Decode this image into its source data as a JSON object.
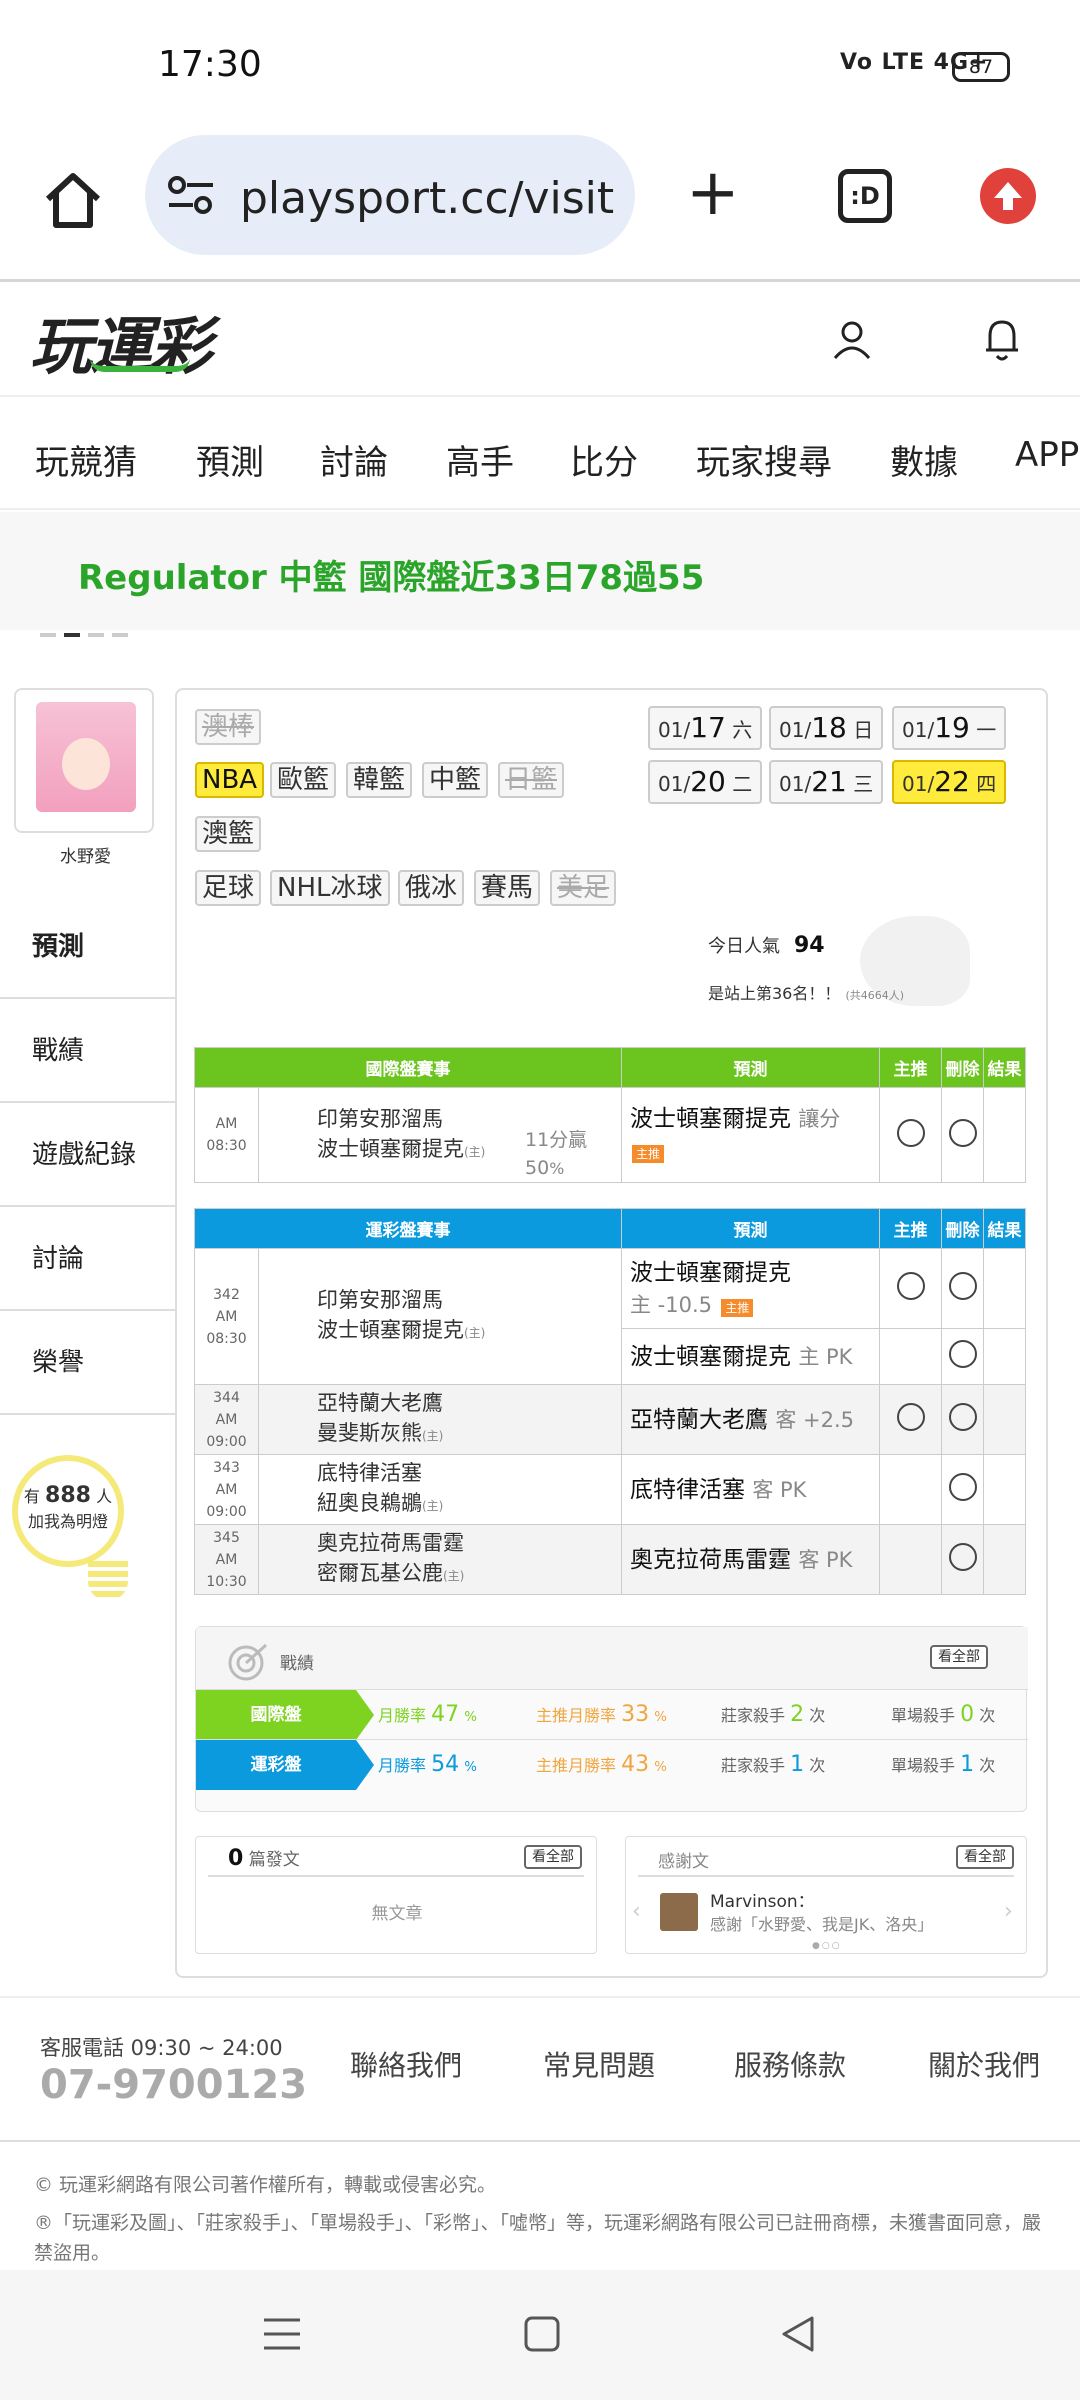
{
  "status_bar": {
    "time": "17:30",
    "signal": "Vo LTE 4G+",
    "battery": "87"
  },
  "browser": {
    "url": "playsport.cc/visit",
    "tabs_label": ":D"
  },
  "site": {
    "logo": "玩運彩"
  },
  "nav": {
    "items": [
      "玩競猜",
      "預測",
      "討論",
      "高手",
      "比分",
      "玩家搜尋",
      "數據",
      "APP"
    ]
  },
  "banner": {
    "text": "Regulator 中籃 國際盤近33日78過55"
  },
  "profile": {
    "name": "水野愛"
  },
  "side_menu": [
    "預測",
    "戰績",
    "遊戲紀錄",
    "討論",
    "榮譽"
  ],
  "fans": {
    "prefix": "有",
    "count": "888",
    "suffix": "人",
    "cta": "加我為明燈"
  },
  "sports": {
    "row1": [
      "澳棒"
    ],
    "row2": [
      "NBA",
      "歐籃",
      "韓籃",
      "中籃",
      "日籃"
    ],
    "row3": [
      "澳籃"
    ],
    "row4": [
      "足球",
      "NHL冰球",
      "俄冰",
      "賽馬",
      "美足"
    ]
  },
  "dates": [
    {
      "md": "01/",
      "d": "17",
      "w": "六"
    },
    {
      "md": "01/",
      "d": "18",
      "w": "日"
    },
    {
      "md": "01/",
      "d": "19",
      "w": "一"
    },
    {
      "md": "01/",
      "d": "20",
      "w": "二"
    },
    {
      "md": "01/",
      "d": "21",
      "w": "三"
    },
    {
      "md": "01/",
      "d": "22",
      "w": "四"
    }
  ],
  "popularity": {
    "label": "今日人氣",
    "value": "94",
    "rank": "是站上第36名！！",
    "total": "(共4664人)"
  },
  "intl_table": {
    "headers": [
      "國際盤賽事",
      "預測",
      "主推",
      "刪除",
      "結果"
    ],
    "row": {
      "time": "AM 08:30",
      "away": "印第安那溜馬",
      "home": "波士頓塞爾提克",
      "home_mark": "(主)",
      "score1": "11分贏",
      "score2": "50",
      "score2_unit": "%",
      "pick": "波士頓塞爾提克",
      "pick_note": "讓分",
      "pick_badge": "主推"
    }
  },
  "sport_table": {
    "headers": [
      "運彩盤賽事",
      "預測",
      "主推",
      "刪除",
      "結果"
    ],
    "rows": [
      {
        "num": "342",
        "time": "AM 08:30",
        "away": "印第安那溜馬",
        "home": "波士頓塞爾提克",
        "pick1": "波士頓塞爾提克",
        "pick1_note": "主 -10.5",
        "pick1_badge": "主推",
        "pick2": "波士頓塞爾提克",
        "pick2_note": "主 PK"
      },
      {
        "num": "344",
        "time": "AM 09:00",
        "away": "亞特蘭大老鷹",
        "home": "曼斐斯灰熊",
        "pick": "亞特蘭大老鷹",
        "pick_note": "客 +2.5"
      },
      {
        "num": "343",
        "time": "AM 09:00",
        "away": "底特律活塞",
        "home": "紐奧良鵜鶘",
        "pick": "底特律活塞",
        "pick_note": "客 PK"
      },
      {
        "num": "345",
        "time": "AM 10:30",
        "away": "奧克拉荷馬雷霆",
        "home": "密爾瓦基公鹿",
        "pick": "奧克拉荷馬雷霆",
        "pick_note": "客 PK"
      }
    ],
    "home_mark": "(主)"
  },
  "record": {
    "title": "戰績",
    "view_all": "看全部",
    "rows": [
      {
        "label": "國際盤",
        "monthly": "月勝率",
        "monthly_v": "47",
        "main": "主推月勝率",
        "main_v": "33",
        "banker": "莊家殺手",
        "banker_v": "2",
        "single": "單場殺手",
        "single_v": "0",
        "pct": "%",
        "unit": "次",
        "color": "#7ed321"
      },
      {
        "label": "運彩盤",
        "monthly": "月勝率",
        "monthly_v": "54",
        "main": "主推月勝率",
        "main_v": "43",
        "banker": "莊家殺手",
        "banker_v": "1",
        "single": "單場殺手",
        "single_v": "1",
        "pct": "%",
        "unit": "次",
        "color": "#0b9ade"
      }
    ]
  },
  "posts": {
    "count": "0",
    "label": "篇發文",
    "view_all": "看全部",
    "empty": "無文章"
  },
  "thanks": {
    "title": "感謝文",
    "view_all": "看全部",
    "user": "Marvinson：",
    "text": "感謝「水野愛、我是JK、洛央」"
  },
  "footer": {
    "tel_label": "客服電話 09:30 ~ 24:00",
    "phone": "07-9700123",
    "links": [
      "聯絡我們",
      "常見問題",
      "服務條款",
      "關於我們"
    ],
    "copyright": "© 玩運彩網路有限公司著作權所有，轉載或侵害必究。",
    "trademark": "®「玩運彩及圖」、「莊家殺手」、「單場殺手」、「彩幣」、「噓幣」等，玩運彩網路有限公司已註冊商標，未獲書面同意，嚴禁盜用。"
  },
  "colors": {
    "green": "#2aa52a",
    "intl_header": "#6cc41f",
    "sport_header": "#0b9ade",
    "highlight": "#ffeb3b",
    "badge": "#f58b2b"
  }
}
